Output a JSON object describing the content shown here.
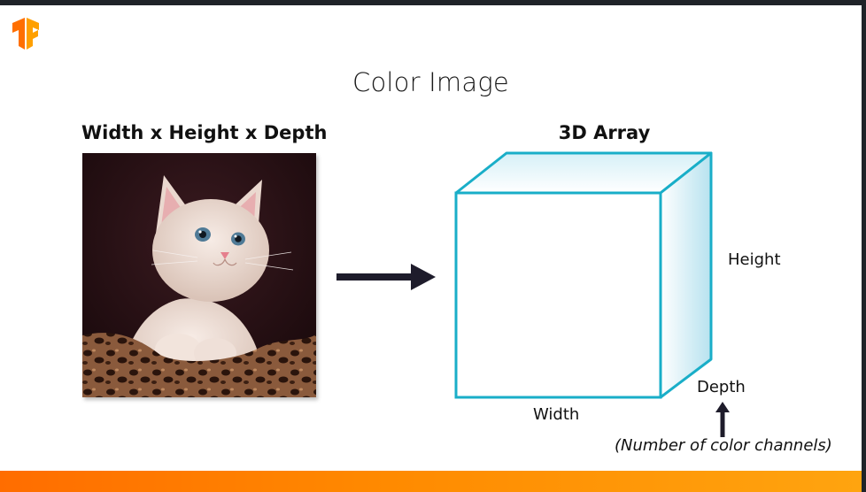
{
  "slide": {
    "title": "Color Image",
    "left_heading": "Width x Height x Depth",
    "right_heading": "3D Array",
    "logo_icon": "tensorflow-logo-icon",
    "image_icon": "kitten-photo",
    "arrow_icon": "right-arrow-icon"
  },
  "cube": {
    "height_label": "Height",
    "depth_label": "Depth",
    "width_label": "Width",
    "note": "(Number of color channels)",
    "stroke_color": "#19aec8",
    "shade_color": "#bfe7f2"
  },
  "colors": {
    "accent": "#ff6d00",
    "bar_end": "#ffa40f",
    "frame": "#1f2328"
  }
}
